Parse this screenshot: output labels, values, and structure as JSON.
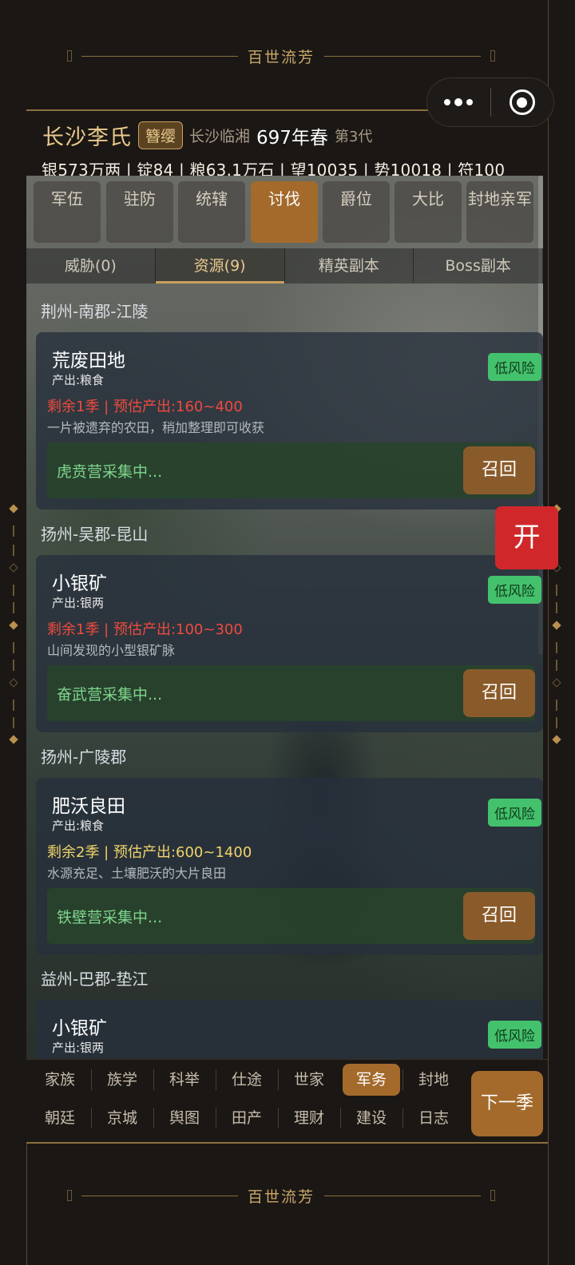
{
  "app": {
    "title": "百世流芳",
    "footer_title": "百世流芳"
  },
  "header": {
    "clan_name": "长沙李氏",
    "rank_badge": "簪缨",
    "location": "长沙临湘",
    "year": "697年春",
    "generation": "第3代",
    "stats_line": "银573万两 | 锭84 | 粮63.1万石 | 望10035 | 势10018 | 符100"
  },
  "main_tabs": [
    {
      "label": "军伍"
    },
    {
      "label": "驻防"
    },
    {
      "label": "统辖"
    },
    {
      "label": "讨伐",
      "active": true
    },
    {
      "label": "爵位"
    },
    {
      "label": "大比"
    },
    {
      "label": "封地亲军"
    }
  ],
  "sub_tabs": [
    {
      "label": "威胁(0)"
    },
    {
      "label": "资源(9)",
      "active": true
    },
    {
      "label": "精英副本"
    },
    {
      "label": "Boss副本"
    }
  ],
  "resources": [
    {
      "region": "荆州-南郡-江陵",
      "name": "荒废田地",
      "risk": "低风险",
      "output": "产出:粮食",
      "remain": "剩余1季 | 预估产出:160~400",
      "remain_color": "red",
      "description": "一片被遗弃的农田，稍加整理即可收获",
      "status": "虎贲营采集中...",
      "action": "召回"
    },
    {
      "region": "扬州-吴郡-昆山",
      "name": "小银矿",
      "risk": "低风险",
      "output": "产出:银两",
      "remain": "剩余1季 | 预估产出:100~300",
      "remain_color": "red",
      "description": "山间发现的小型银矿脉",
      "status": "奋武营采集中...",
      "action": "召回"
    },
    {
      "region": "扬州-广陵郡",
      "name": "肥沃良田",
      "risk": "低风险",
      "output": "产出:粮食",
      "remain": "剩余2季 | 预估产出:600~1400",
      "remain_color": "yellow",
      "description": "水源充足、土壤肥沃的大片良田",
      "status": "铁壁营采集中...",
      "action": "召回"
    },
    {
      "region": "益州-巴郡-垫江",
      "name": "小银矿",
      "risk": "低风险",
      "output": "产出:银两"
    }
  ],
  "floating_button": "开",
  "bottom_nav": {
    "row1": [
      "家族",
      "族学",
      "科举",
      "仕途",
      "世家",
      "军务",
      "封地"
    ],
    "row2": [
      "朝廷",
      "京城",
      "舆图",
      "田产",
      "理财",
      "建设",
      "日志"
    ],
    "active": "军务",
    "next_label": "下一季"
  }
}
